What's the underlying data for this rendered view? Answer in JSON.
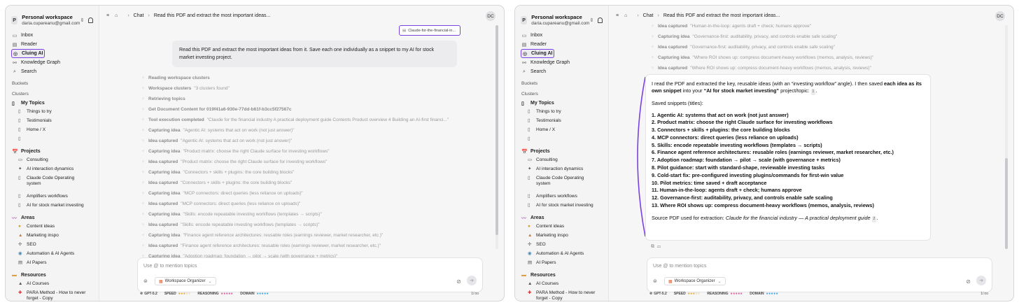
{
  "sidebar": {
    "workspace_avatar": "P",
    "workspace_name": "Personal workspace",
    "workspace_email": "daria.cupareanu@gmail.com",
    "nav": [
      {
        "icon": "▭",
        "label": "Inbox"
      },
      {
        "icon": "▤",
        "label": "Reader"
      },
      {
        "icon": "◎",
        "label": "Cluing AI"
      },
      {
        "icon": "⚯",
        "label": "Knowledge Graph"
      },
      {
        "icon": "⌕",
        "label": "Search"
      }
    ],
    "buckets_label": "Buckets",
    "clusters_label": "Clusters",
    "my_topics": {
      "icon": "▯",
      "label": "My Topics",
      "items": [
        "Things to try",
        "Testimonials",
        "Home / X",
        ""
      ]
    },
    "projects": {
      "icon": "📅",
      "label": "Projects",
      "items": [
        "Consulting",
        "AI interaction dynamics",
        "Claude Code Operating system",
        "Amplifiers workflows",
        "AI for stock market investing"
      ]
    },
    "areas": {
      "icon": "〰",
      "label": "Areas",
      "items": [
        "Content ideas",
        "Marketing inspo",
        "SEO",
        "Automation & AI Agents",
        "AI Papers"
      ]
    },
    "resources": {
      "icon": "▬",
      "label": "Resources",
      "items": [
        "AI Courses",
        "PARA Method - How to never forget - Copy"
      ]
    }
  },
  "topbar": {
    "section": "Chat",
    "title": "Read this PDF and extract the most important ideas...",
    "avatar": "DC"
  },
  "chat": {
    "attachment": "Claude-for-the-financial-in...",
    "user_message": "Read this PDF and extract the most important ideas from it. Save each one individually as a snippet to my AI for stock market investing project.",
    "steps": [
      {
        "label": "Reading workspace clusters",
        "value": ""
      },
      {
        "label": "Workspace clusters",
        "value": "\"3 clusters found\""
      },
      {
        "label": "Retrieving topics",
        "value": ""
      },
      {
        "label": "Get Document Content for 019f41a6-930e-77dd-b61f-b3cc5f27567c",
        "value": ""
      },
      {
        "label": "Tool execution completed",
        "value": "\"Claude for the financial industry A practical deployment guide Contents Product overview 4 Building an AI-first financi...\""
      },
      {
        "label": "Capturing idea",
        "value": "\"Agentic AI: systems that act on work (not just answer)\""
      },
      {
        "label": "Idea captured",
        "value": "\"Agentic AI: systems that act on work (not just answer)\""
      },
      {
        "label": "Capturing idea",
        "value": "\"Product matrix: choose the right Claude surface for investing workflows\""
      },
      {
        "label": "Idea captured",
        "value": "\"Product matrix: choose the right Claude surface for investing workflows\""
      },
      {
        "label": "Capturing idea",
        "value": "\"Connectors + skills + plugins: the core building blocks\""
      },
      {
        "label": "Idea captured",
        "value": "\"Connectors + skills + plugins: the core building blocks\""
      },
      {
        "label": "Capturing idea",
        "value": "\"MCP connectors: direct queries (less reliance on uploads)\""
      },
      {
        "label": "Idea captured",
        "value": "\"MCP connectors: direct queries (less reliance on uploads)\""
      },
      {
        "label": "Capturing idea",
        "value": "\"Skills: encode repeatable investing workflows (templates → scripts)\""
      },
      {
        "label": "Idea captured",
        "value": "\"Skills: encode repeatable investing workflows (templates → scripts)\""
      },
      {
        "label": "Capturing idea",
        "value": "\"Finance agent reference architectures: reusable roles (earnings reviewer, market researcher, etc.)\""
      },
      {
        "label": "Idea captured",
        "value": "\"Finance agent reference architectures: reusable roles (earnings reviewer, market researcher, etc.)\""
      },
      {
        "label": "Capturing idea",
        "value": "\"Adoption roadmap: foundation → pilot → scale (with governance + metrics)\""
      }
    ],
    "prev_steps": [
      {
        "label": "Idea captured",
        "value": "\"Human-in-the-loop: agents draft + check; humans approve\""
      },
      {
        "label": "Capturing idea",
        "value": "\"Governance-first: auditability, privacy, and controls enable safe scaling\""
      },
      {
        "label": "Idea captured",
        "value": "\"Governance-first: auditability, privacy, and controls enable safe scaling\""
      },
      {
        "label": "Capturing idea",
        "value": "\"Where ROI shows up: compress document-heavy workflows (memos, analysis, reviews)\""
      },
      {
        "label": "Idea captured",
        "value": "\"Where ROI shows up: compress document-heavy workflows (memos, analysis, reviews)\""
      }
    ],
    "answer": {
      "intro_1": "I read the PDF and extracted the key, reusable ideas (with an “investing workflow” angle). I then saved ",
      "intro_bold": "each idea as its own snippet",
      "intro_2": " into your ",
      "intro_project": "“AI for stock market investing”",
      "intro_3": " project/topic:",
      "cite_1": "1",
      "saved_label": "Saved snippets (titles):",
      "items": [
        "1. Agentic AI: systems that act on work (not just answer)",
        "2. Product matrix: choose the right Claude surface for investing workflows",
        "3. Connectors + skills + plugins: the core building blocks",
        "4. MCP connectors: direct queries (less reliance on uploads)",
        "5. Skills: encode repeatable investing workflows (templates → scripts)",
        "6. Finance agent reference architectures: reusable roles (earnings reviewer, market researcher, etc.)",
        "7. Adoption roadmap: foundation → pilot → scale (with governance + metrics)",
        "8. Pilot guidance: start with standard-shape, reviewable investing tasks",
        "9. Cold-start fix: pre-configured investing plugins/commands for first-win value",
        "10. Pilot metrics: time saved + draft acceptance",
        "11. Human-in-the-loop: agents draft + check; humans approve",
        "12. Governance-first: auditability, privacy, and controls enable safe scaling",
        "13. Where ROI shows up: compress document-heavy workflows (memos, analysis, reviews)"
      ],
      "source_label": "Source PDF used for extraction: ",
      "source_title": "Claude for the financial industry — A practical deployment guide",
      "cite_2": "2"
    }
  },
  "composer": {
    "placeholder": "Use @ to mention topics",
    "workspace_tool": "Workspace Organizer",
    "model": "GPT-5.2",
    "speed_label": "SPEED",
    "reasoning_label": "REASONING",
    "domain_label": "DOMAIN",
    "ratio": "1/ oo"
  },
  "colors": {
    "accent": "#7b3fe4",
    "speed": "#e0a92a",
    "reasoning": "#e0569a",
    "domain": "#3aa6e0"
  }
}
